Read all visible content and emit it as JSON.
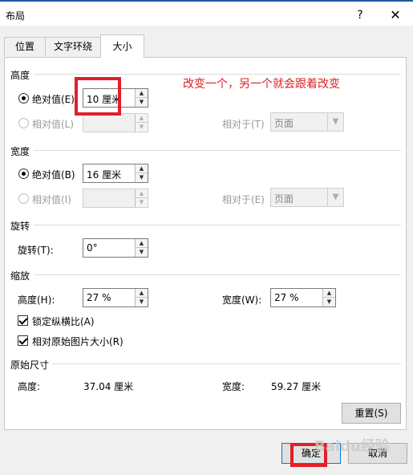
{
  "window": {
    "title": "布局",
    "help": "?",
    "close": "✕"
  },
  "tabs": [
    {
      "label": "位置",
      "active": false
    },
    {
      "label": "文字环绕",
      "active": false
    },
    {
      "label": "大小",
      "active": true
    }
  ],
  "height": {
    "section": "高度",
    "absolute_label": "绝对值(E)",
    "absolute_value": "10 厘米",
    "relative_label": "相对值(L)",
    "relative_to_label": "相对于(T)",
    "relative_to_value": "页面"
  },
  "width": {
    "section": "宽度",
    "absolute_label": "绝对值(B)",
    "absolute_value": "16 厘米",
    "relative_label": "相对值(I)",
    "relative_to_label": "相对于(E)",
    "relative_to_value": "页面"
  },
  "rotation": {
    "section": "旋转",
    "label": "旋转(T):",
    "value": "0°"
  },
  "scale": {
    "section": "缩放",
    "height_label": "高度(H):",
    "height_value": "27 %",
    "width_label": "宽度(W):",
    "width_value": "27 %",
    "lock_aspect": "锁定纵横比(A)",
    "relative_original": "相对原始图片大小(R)"
  },
  "original": {
    "section": "原始尺寸",
    "height_label": "高度:",
    "height_value": "37.04 厘米",
    "width_label": "宽度:",
    "width_value": "59.27 厘米"
  },
  "buttons": {
    "reset": "重置(S)",
    "ok": "确定",
    "cancel": "取消"
  },
  "annotation": "改变一个，另一个就会跟着改变",
  "watermark": "Baidu经验",
  "colors": {
    "annotation_red": "#e0202a",
    "accent_blue": "#0078d7"
  }
}
